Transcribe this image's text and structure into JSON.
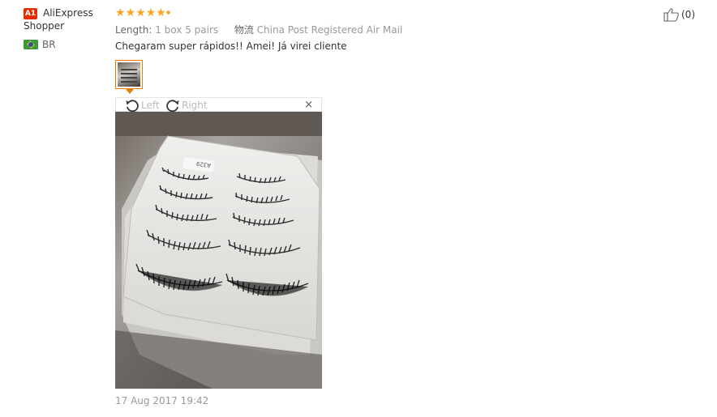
{
  "reviewer": {
    "badge": "A1",
    "name": "AliExpress Shopper",
    "country_code": "BR"
  },
  "review": {
    "rating": 5,
    "length_label": "Length:",
    "length_value": "1 box 5 pairs",
    "shipping_label": "物流",
    "shipping_value": "China Post Registered Air Mail",
    "comment": "Chegaram super rápidos!! Amei! Já virei cliente",
    "date": "17 Aug 2017 19:42",
    "helpful_count": "(0)"
  },
  "viewer": {
    "rotate_left": "Left",
    "rotate_right": "Right",
    "close": "×"
  },
  "colors": {
    "star": "#f5a623",
    "accent": "#e67e00",
    "badge": "#e62e04"
  }
}
